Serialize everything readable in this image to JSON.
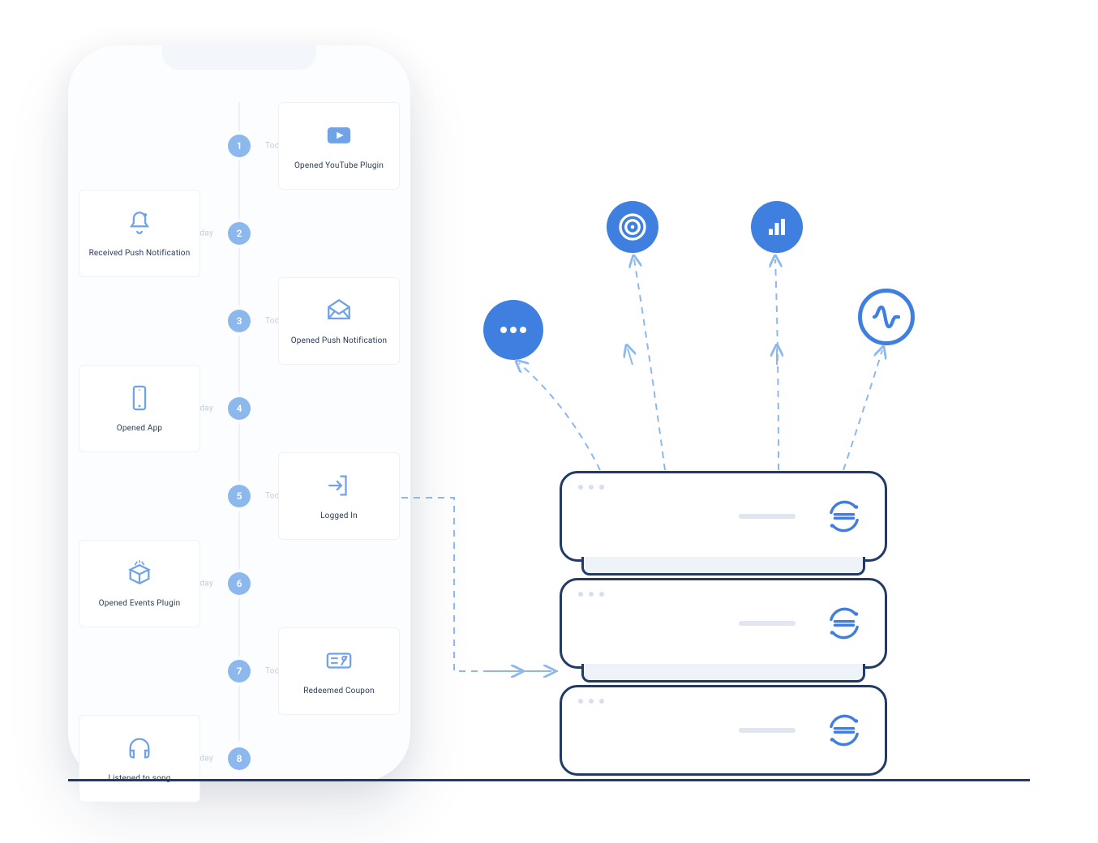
{
  "timeline": {
    "day_label": "Today",
    "items": [
      {
        "n": "1",
        "label": "Opened YouTube Plugin",
        "icon": "youtube",
        "side": "right"
      },
      {
        "n": "2",
        "label": "Received Push Notification",
        "icon": "bell",
        "side": "left"
      },
      {
        "n": "3",
        "label": "Opened Push Notification",
        "icon": "envelope",
        "side": "right"
      },
      {
        "n": "4",
        "label": "Opened App",
        "icon": "phone",
        "side": "left"
      },
      {
        "n": "5",
        "label": "Logged In",
        "icon": "login",
        "side": "right"
      },
      {
        "n": "6",
        "label": "Opened Events Plugin",
        "icon": "box",
        "side": "left"
      },
      {
        "n": "7",
        "label": "Redeemed Coupon",
        "icon": "coupon",
        "side": "right"
      },
      {
        "n": "8",
        "label": "Listened to song",
        "icon": "headphones",
        "side": "left"
      }
    ]
  },
  "integrations": {
    "more": "more-icon",
    "target": "target-icon",
    "chart": "bar-chart-icon",
    "wave": "amplitude-icon"
  },
  "servers": {
    "count": 3,
    "brand": "segment-logo"
  }
}
